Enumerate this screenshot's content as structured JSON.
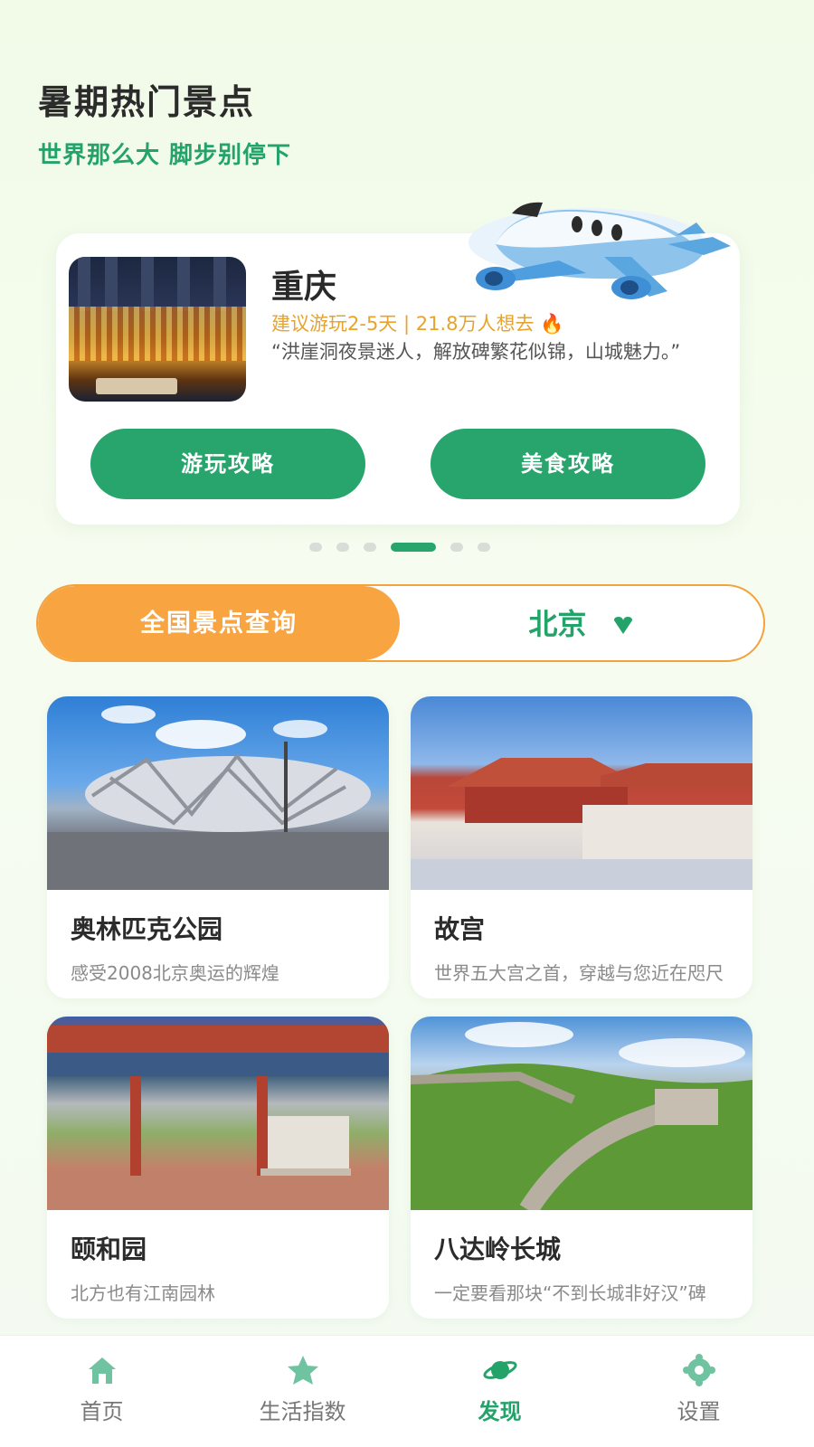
{
  "header": {
    "title": "暑期热门景点",
    "subtitle": "世界那么大  脚步别停下"
  },
  "banner": {
    "city": "重庆",
    "meta": "建议游玩2-5天 | 21.8万人想去 🔥",
    "quote": "“洪崖洞夜景迷人，解放碑繁花似锦，山城魅力。”",
    "buttons": [
      "游玩攻略",
      "美食攻略"
    ],
    "slide_count": 6,
    "active_slide": 4
  },
  "query": {
    "left_label": "全国景点查询",
    "city": "北京"
  },
  "spots": [
    {
      "name": "奥林匹克公园",
      "desc": "感受2008北京奥运的辉煌"
    },
    {
      "name": "故宫",
      "desc": "世界五大宫之首，穿越与您近在咫尺"
    },
    {
      "name": "颐和园",
      "desc": "北方也有江南园林"
    },
    {
      "name": "八达岭长城",
      "desc": "一定要看那块“不到长城非好汉”碑"
    }
  ],
  "tabbar": {
    "items": [
      {
        "label": "首页",
        "icon": "home-icon"
      },
      {
        "label": "生活指数",
        "icon": "star-icon"
      },
      {
        "label": "发现",
        "icon": "planet-icon"
      },
      {
        "label": "设置",
        "icon": "gear-icon"
      }
    ],
    "active": 2
  },
  "colors": {
    "accent_green": "#27a56c",
    "accent_orange": "#f8a440",
    "meta_orange": "#e8a32a"
  }
}
